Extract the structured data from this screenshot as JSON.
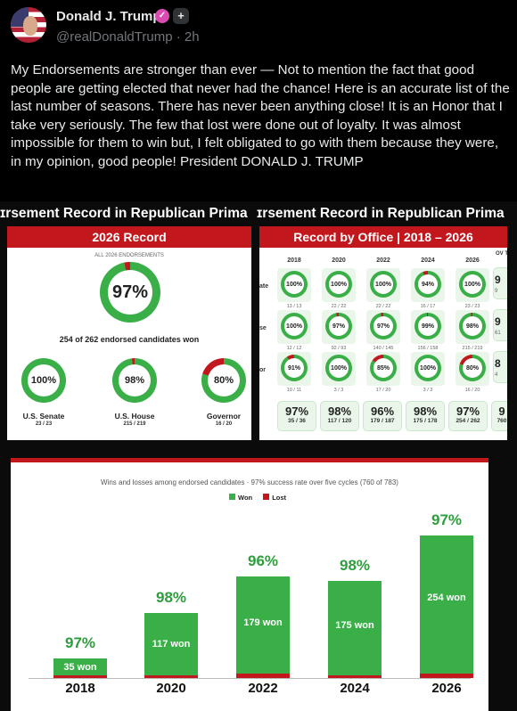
{
  "post": {
    "author": "Donald J. Trump",
    "handle_time": "@realDonaldTrump · 2h",
    "text": "My Endorsements are stronger than ever — Not to mention the fact that good people are getting elected that never had the chance! Here is an accurate list of the last number of seasons. There has never been anything close! It is an Honor that I take very seriously. The few that lost were done out of loyalty. It was almost impossible for them to win but, I felt obligated to go with them because they were, in my opinion, good people! President DONALD J. TRUMP"
  },
  "graphic": {
    "banner_fragment": "ɪrsement Record in Republican Prima",
    "colors": {
      "red": "#c2171d",
      "green": "#3aaf47"
    },
    "record_2026": {
      "title": "2026 Record",
      "caption": "ALL 2026 ENDORSEMENTS",
      "overall_pct": "97%",
      "summary": "254 of 262 endorsed candidates won",
      "offices": [
        {
          "pct": "100%",
          "label": "U.S. Senate",
          "count": "23 / 23",
          "value": 1.0
        },
        {
          "pct": "98%",
          "label": "U.S. House",
          "count": "215 / 219",
          "value": 0.98
        },
        {
          "pct": "80%",
          "label": "Governor",
          "count": "16 / 20",
          "value": 0.8
        }
      ]
    },
    "by_office": {
      "title": "Record by Office | 2018 – 2026",
      "years": [
        "2018",
        "2020",
        "2022",
        "2024",
        "2026"
      ],
      "extra_col_head": "OV T",
      "row_labels": [
        "ate",
        "se",
        "or"
      ],
      "rows": [
        {
          "cells": [
            {
              "pct": "100%",
              "count": "13 / 13",
              "value": 1.0
            },
            {
              "pct": "100%",
              "count": "22 / 22",
              "value": 1.0
            },
            {
              "pct": "100%",
              "count": "22 / 22",
              "value": 1.0
            },
            {
              "pct": "94%",
              "count": "16 / 17",
              "value": 0.94
            },
            {
              "pct": "100%",
              "count": "23 / 23",
              "value": 1.0
            }
          ],
          "overall": "9",
          "overall_sub": "9"
        },
        {
          "cells": [
            {
              "pct": "100%",
              "count": "12 / 12",
              "value": 1.0
            },
            {
              "pct": "97%",
              "count": "92 / 93",
              "value": 0.97
            },
            {
              "pct": "97%",
              "count": "140 / 145",
              "value": 0.97
            },
            {
              "pct": "99%",
              "count": "156 / 158",
              "value": 0.99
            },
            {
              "pct": "98%",
              "count": "215 / 219",
              "value": 0.98
            }
          ],
          "overall": "9",
          "overall_sub": "61"
        },
        {
          "cells": [
            {
              "pct": "91%",
              "count": "10 / 11",
              "value": 0.91
            },
            {
              "pct": "100%",
              "count": "3 / 3",
              "value": 1.0
            },
            {
              "pct": "85%",
              "count": "17 / 20",
              "value": 0.85
            },
            {
              "pct": "100%",
              "count": "3 / 3",
              "value": 1.0
            },
            {
              "pct": "80%",
              "count": "16 / 20",
              "value": 0.8
            }
          ],
          "overall": "8",
          "overall_sub": "4"
        }
      ],
      "totals": [
        {
          "pct": "97%",
          "count": "35 / 36"
        },
        {
          "pct": "98%",
          "count": "117 / 120"
        },
        {
          "pct": "96%",
          "count": "179 / 187"
        },
        {
          "pct": "98%",
          "count": "175 / 178"
        },
        {
          "pct": "97%",
          "count": "254 / 262"
        },
        {
          "pct": "9",
          "count": "760"
        }
      ]
    },
    "chart_data": {
      "type": "bar",
      "subtitle": "Wins and losses among endorsed candidates · 97% success rate over five cycles (760 of 783)",
      "legend": [
        "Won",
        "Lost"
      ],
      "categories": [
        "2018",
        "2020",
        "2022",
        "2024",
        "2026"
      ],
      "series": [
        {
          "name": "Won",
          "values": [
            35,
            117,
            179,
            175,
            254
          ]
        },
        {
          "name": "Lost",
          "values": [
            1,
            3,
            8,
            3,
            8
          ]
        }
      ],
      "pct_labels": [
        "97%",
        "98%",
        "96%",
        "98%",
        "97%"
      ],
      "bar_labels": [
        "35 won",
        "117 won",
        "179 won",
        "175 won",
        "254 won"
      ],
      "ylim": [
        0,
        262
      ]
    }
  }
}
